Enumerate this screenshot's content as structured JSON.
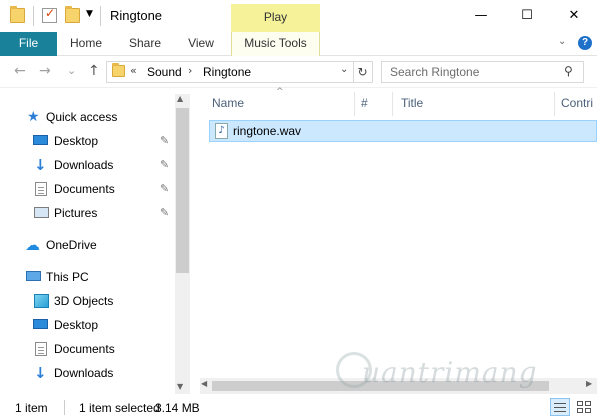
{
  "window": {
    "title": "Ringtone",
    "context_tab_group": "Play",
    "controls": {
      "minimize": "—",
      "maximize": "☐",
      "close": "✕"
    }
  },
  "ribbon": {
    "tabs": [
      "File",
      "Home",
      "Share",
      "View",
      "Music Tools"
    ],
    "file_accent": "#19829a",
    "context_color": "#f5f29a"
  },
  "navigation": {
    "back": "←",
    "forward": "→",
    "recent": "⌄",
    "up": "↑"
  },
  "address": {
    "overflow": "«",
    "parts": [
      "Sound",
      "Ringtone"
    ],
    "separator": "›"
  },
  "search": {
    "placeholder": "Search Ringtone"
  },
  "nav_pane": {
    "items": [
      {
        "label": "Quick access",
        "icon": "star-icon"
      },
      {
        "label": "Desktop",
        "icon": "desktop-icon",
        "pinned": true
      },
      {
        "label": "Downloads",
        "icon": "download-arrow-icon",
        "pinned": true
      },
      {
        "label": "Documents",
        "icon": "document-icon",
        "pinned": true
      },
      {
        "label": "Pictures",
        "icon": "pictures-icon",
        "pinned": true
      },
      {
        "label": "OneDrive",
        "icon": "cloud-icon"
      },
      {
        "label": "This PC",
        "icon": "computer-icon"
      },
      {
        "label": "3D Objects",
        "icon": "cube-icon"
      },
      {
        "label": "Desktop",
        "icon": "desktop-icon"
      },
      {
        "label": "Documents",
        "icon": "document-icon"
      },
      {
        "label": "Downloads",
        "icon": "download-arrow-icon"
      }
    ],
    "pin_glyph": "📌"
  },
  "columns": [
    "Name",
    "#",
    "Title",
    "Contri"
  ],
  "files": [
    {
      "name": "ringtone.wav",
      "icon": "audio-file-icon",
      "selected": true
    }
  ],
  "status": {
    "count": "1 item",
    "selected": "1 item selected",
    "size": "3.14 MB"
  },
  "watermark": "uantrimang"
}
